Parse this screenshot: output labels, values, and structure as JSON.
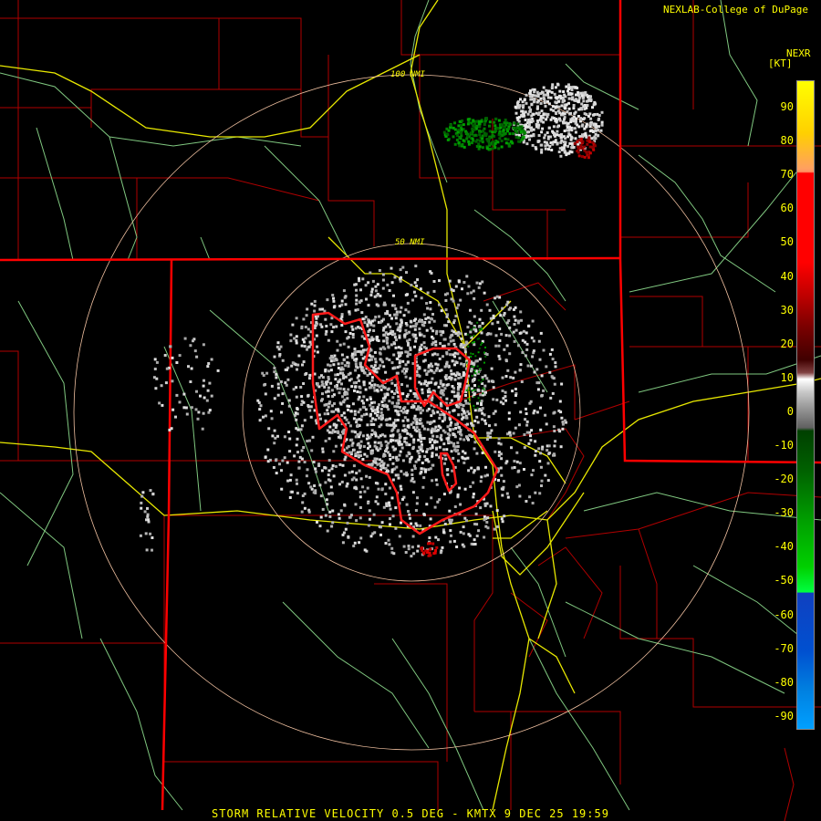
{
  "credit": "NEXLAB-College of DuPage",
  "legend": {
    "title": "NEXR",
    "unit": "[KT]",
    "ticks": [
      "90",
      "80",
      "70",
      "60",
      "50",
      "40",
      "30",
      "20",
      "10",
      "0",
      "-10",
      "-20",
      "-30",
      "-40",
      "-50",
      "-60",
      "-70",
      "-80",
      "-90"
    ]
  },
  "rings": {
    "inner": "50 NMI",
    "outer": "100 NMI"
  },
  "caption": "STORM RELATIVE VELOCITY 0.5 DEG - KMTX 9 DEC 25 19:59",
  "colors": {
    "background": "#000000",
    "state_border": "#ff0000",
    "county": "#b00000",
    "highway": "#ffff00",
    "road": "#90e090",
    "range_ring": "#f0c0a0",
    "warning": "#ff1010"
  }
}
